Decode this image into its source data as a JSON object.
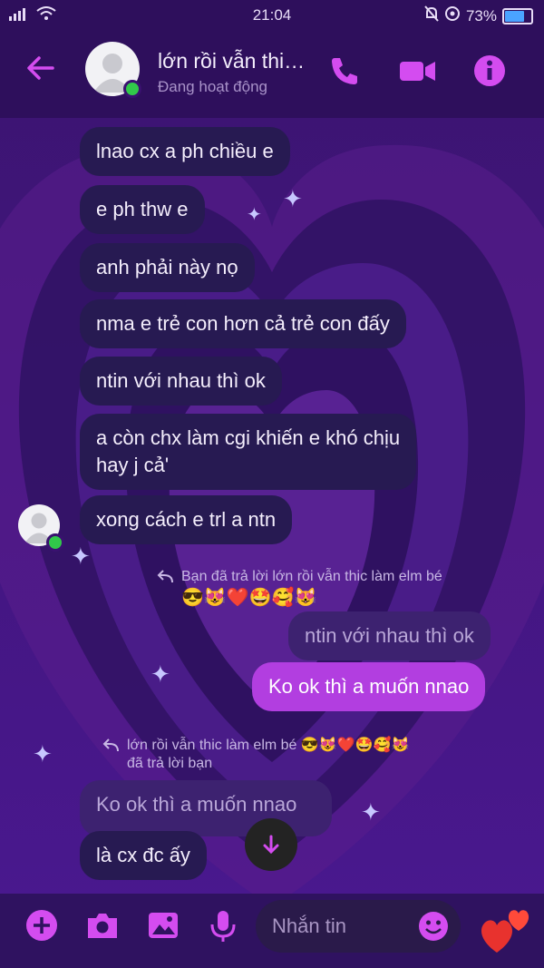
{
  "status_bar": {
    "time": "21:04",
    "battery": "73%"
  },
  "header": {
    "contact_name": "lớn rồi vẫn thi…",
    "presence": "Đang hoạt động"
  },
  "messages": [
    {
      "text": "lnao cx a ph chiều e",
      "from": "them"
    },
    {
      "text": "e ph thw e",
      "from": "them"
    },
    {
      "text": "anh phải này nọ",
      "from": "them"
    },
    {
      "text": "nma e trẻ con hơn cả trẻ con đấy",
      "from": "them"
    },
    {
      "text": "ntin với nhau thì ok",
      "from": "them"
    },
    {
      "text_line1": "a còn chx làm cgi khiến e khó chịu",
      "text_line2": "hay j cả'",
      "from": "them"
    },
    {
      "text": "xong cách e trl a ntn",
      "from": "them"
    }
  ],
  "reply1": {
    "note": "Bạn đã trả lời lớn rồi vẫn thic làm elm bé",
    "emojis": "😎😻❤️🤩🥰😻",
    "quoted": "ntin với nhau thì ok",
    "message": "Ko ok thì a muốn nnao"
  },
  "reply2": {
    "note_name": "lớn rồi vẫn thic làm elm bé",
    "emojis": "😎😻❤️🤩🥰😻",
    "note_tail": "đã trả lời bạn",
    "quoted": "Ko ok thì a muốn nnao",
    "message": "là cx đc ấy"
  },
  "composer": {
    "placeholder": "Nhắn tin"
  },
  "colors": {
    "accent": "#d44cf0",
    "outgoing_bubble": "#b23ee0",
    "incoming_bubble": "#271a52",
    "background": "#3a1170"
  }
}
